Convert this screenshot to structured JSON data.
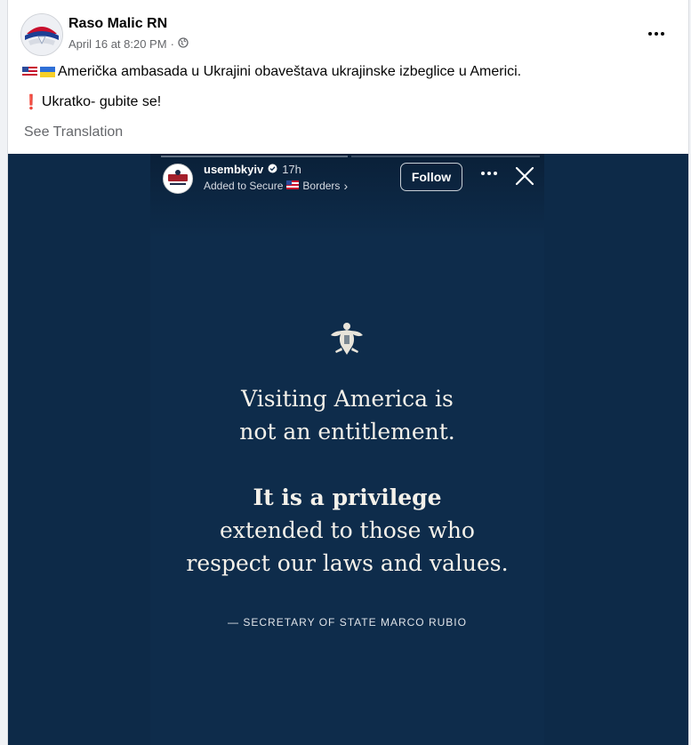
{
  "post": {
    "author": "Raso Malic RN",
    "date": "April 16 at 8:20 PM",
    "separator": "·",
    "line1_text": "Američka ambasada u Ukrajini obaveštava ukrajinske izbeglice u Americi.",
    "line2_mark": "❗",
    "line2_text": "Ukratko- gubite se!",
    "see_translation": "See Translation"
  },
  "story": {
    "username": "usembkyiv",
    "time": "17h",
    "added_prefix": "Added to Secure",
    "added_suffix": "Borders",
    "chevron": "›",
    "follow_label": "Follow",
    "quote_line1": "Visiting America is",
    "quote_line2": "not an entitlement.",
    "quote_line3": "It is a privilege",
    "quote_line4": "extended to those who",
    "quote_line5": "respect our laws and values.",
    "attribution": "— SECRETARY OF STATE MARCO RUBIO"
  },
  "colors": {
    "story_bg": "#0e2c4b",
    "media_bg": "#0d2a48",
    "quote_text": "#f4f1ea",
    "meta_grey": "#65676b"
  },
  "icons": {
    "globe": "globe-icon",
    "more": "more-horizontal-icon",
    "close": "close-icon",
    "verified": "verified-badge-icon",
    "seal": "eagle-seal-icon"
  }
}
